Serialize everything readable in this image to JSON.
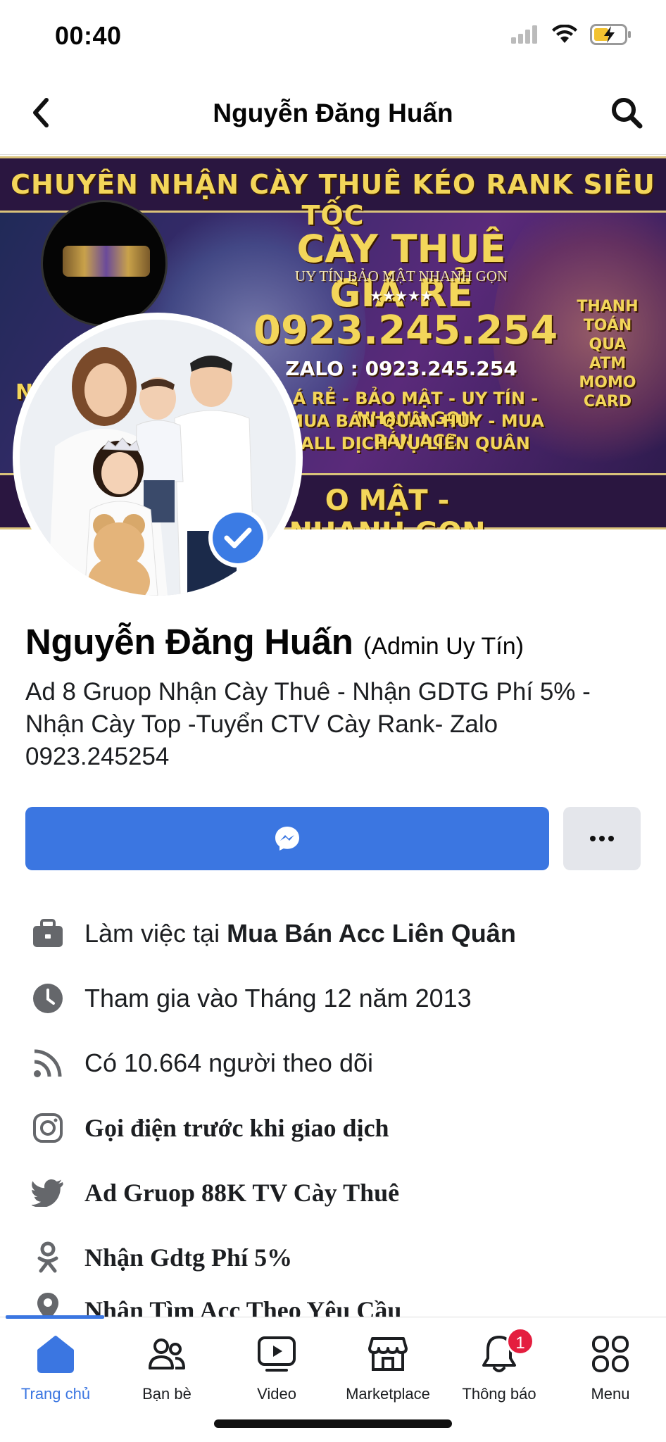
{
  "status_bar": {
    "time": "00:40"
  },
  "header": {
    "title": "Nguyễn Đăng Huấn"
  },
  "cover": {
    "headline": "CHUYÊN NHẬN CÀY THUÊ KÉO RANK SIÊU TỐC",
    "big": "CÀY THUÊ GIÁ RẺ",
    "sub": "UY TÍN BẢO MẬT NHANH GỌN",
    "stars": "★★★★★",
    "phone": "0923.245.254",
    "zalo": "ZALO : 0923.245.254",
    "line1": "Á RẺ - BẢO MẬT - UY TÍN - NHANH GỌN",
    "line2": "MUA BÁN QUÂN HUY - MUA BÁN ACC",
    "line3": "ALL DỊCH VỤ LIÊN QUÂN",
    "bottom": "O MẬT - NHANH GỌN",
    "side": "THANH TOÁN QUA ATM MOMO CARD",
    "left_fragment": "N"
  },
  "profile": {
    "name": "Nguyễn Đăng Huấn",
    "alt_name": "(Admin Uy Tín)",
    "bio": "Ad 8 Gruop Nhận Cày Thuê - Nhận GDTG Phí 5% -Nhận Cày Top -Tuyển CTV Cày Rank- Zalo 0923.245254"
  },
  "info": [
    {
      "icon": "briefcase-icon",
      "prefix": "Làm việc tại ",
      "bold": "Mua Bán Acc Liên Quân"
    },
    {
      "icon": "clock-icon",
      "text": "Tham gia vào Tháng 12 năm 2013"
    },
    {
      "icon": "rss-icon",
      "text": "Có 10.664 người theo dõi"
    },
    {
      "icon": "instagram-icon",
      "text": "Gọi điện trước khi giao dịch"
    },
    {
      "icon": "twitter-icon",
      "text": "Ad Gruop 88K TV Cày Thuê"
    },
    {
      "icon": "odnoklassniki-icon",
      "text": "Nhận Gdtg Phí  5%"
    },
    {
      "icon": "location-icon",
      "text": "Nhận Tìm Acc Theo Yêu Cầu"
    }
  ],
  "tabs": [
    {
      "label": "Trang chủ",
      "icon": "home-icon"
    },
    {
      "label": "Bạn bè",
      "icon": "friends-icon"
    },
    {
      "label": "Video",
      "icon": "video-icon"
    },
    {
      "label": "Marketplace",
      "icon": "marketplace-icon"
    },
    {
      "label": "Thông báo",
      "icon": "bell-icon",
      "badge": "1"
    },
    {
      "label": "Menu",
      "icon": "menu-grid-icon"
    }
  ],
  "colors": {
    "accent": "#3b76e1",
    "badge": "#e41e3f",
    "secondary_button": "#e4e6eb"
  }
}
